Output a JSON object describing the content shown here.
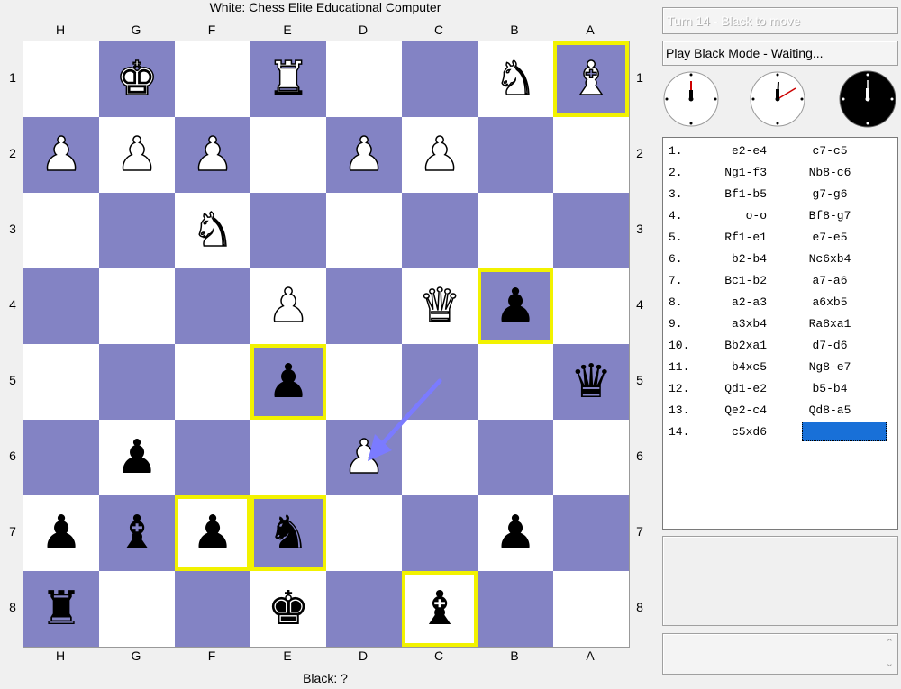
{
  "board_view": {
    "top_title": "White: Chess Elite Educational Computer",
    "bottom_title": "Black: ?",
    "files": [
      "H",
      "G",
      "F",
      "E",
      "D",
      "C",
      "B",
      "A"
    ],
    "ranks": [
      "1",
      "2",
      "3",
      "4",
      "5",
      "6",
      "7",
      "8"
    ],
    "colors": {
      "light_square": "#ffffff",
      "dark_square": "#8383c4",
      "highlight": "#f2f200",
      "arrow": "#7b7bff"
    },
    "squares": [
      [
        "",
        "♚",
        "",
        "♜",
        "",
        "",
        "♞",
        "♝"
      ],
      [
        "♟",
        "♟",
        "♟",
        "",
        "♟",
        "♟",
        "",
        ""
      ],
      [
        "",
        "",
        "♞",
        "",
        "",
        "",
        "",
        ""
      ],
      [
        "",
        "",
        "",
        "♟",
        "",
        "♛",
        "♟",
        ""
      ],
      [
        "",
        "",
        "",
        "♟",
        "",
        "",
        "",
        "♛"
      ],
      [
        "",
        "♟",
        "",
        "",
        "♟",
        "",
        "",
        ""
      ],
      [
        "♟",
        "♝",
        "♟",
        "♞",
        "",
        "",
        "♟",
        ""
      ],
      [
        "♜",
        "",
        "",
        "♚",
        "",
        "♝",
        "",
        ""
      ]
    ],
    "piece_colors": [
      [
        "",
        "w",
        "",
        "w",
        "",
        "",
        "w",
        "w"
      ],
      [
        "w",
        "w",
        "w",
        "",
        "w",
        "w",
        "",
        ""
      ],
      [
        "",
        "",
        "w",
        "",
        "",
        "",
        "",
        ""
      ],
      [
        "",
        "",
        "",
        "w",
        "",
        "w",
        "b",
        ""
      ],
      [
        "",
        "",
        "",
        "b",
        "",
        "",
        "",
        "b"
      ],
      [
        "",
        "b",
        "",
        "",
        "w",
        "",
        "",
        ""
      ],
      [
        "b",
        "b",
        "b",
        "b",
        "",
        "",
        "b",
        ""
      ],
      [
        "b",
        "",
        "",
        "b",
        "",
        "b",
        "",
        ""
      ]
    ],
    "highlighted_squares": [
      "A1",
      "B4",
      "E5",
      "F7",
      "E7",
      "C8"
    ],
    "last_move_arrow": {
      "from": "C5",
      "to": "D6"
    }
  },
  "status": {
    "turn": "Turn 14 - Black to move",
    "mode": "Play Black Mode - Waiting..."
  },
  "clocks": [
    {
      "name": "clock-1",
      "face": "#ffffff",
      "hand": "#cc0000"
    },
    {
      "name": "clock-2",
      "face": "#ffffff",
      "hand": "#cc0000"
    },
    {
      "name": "clock-3",
      "face": "#000000",
      "hand": "#ffffff"
    }
  ],
  "moves": [
    {
      "num": "1.",
      "white": "e2-e4",
      "black": "c7-c5"
    },
    {
      "num": "2.",
      "white": "Ng1-f3",
      "black": "Nb8-c6"
    },
    {
      "num": "3.",
      "white": "Bf1-b5",
      "black": "g7-g6"
    },
    {
      "num": "4.",
      "white": "o-o",
      "black": "Bf8-g7"
    },
    {
      "num": "5.",
      "white": "Rf1-e1",
      "black": "e7-e5"
    },
    {
      "num": "6.",
      "white": "b2-b4",
      "black": "Nc6xb4"
    },
    {
      "num": "7.",
      "white": "Bc1-b2",
      "black": "a7-a6"
    },
    {
      "num": "8.",
      "white": "a2-a3",
      "black": "a6xb5"
    },
    {
      "num": "9.",
      "white": "a3xb4",
      "black": "Ra8xa1"
    },
    {
      "num": "10.",
      "white": "Bb2xa1",
      "black": "d7-d6"
    },
    {
      "num": "11.",
      "white": "b4xc5",
      "black": "Ng8-e7"
    },
    {
      "num": "12.",
      "white": "Qd1-e2",
      "black": "b5-b4"
    },
    {
      "num": "13.",
      "white": "Qe2-c4",
      "black": "Qd8-a5"
    },
    {
      "num": "14.",
      "white": "c5xd6",
      "black": ""
    }
  ],
  "input": {
    "value": ""
  }
}
